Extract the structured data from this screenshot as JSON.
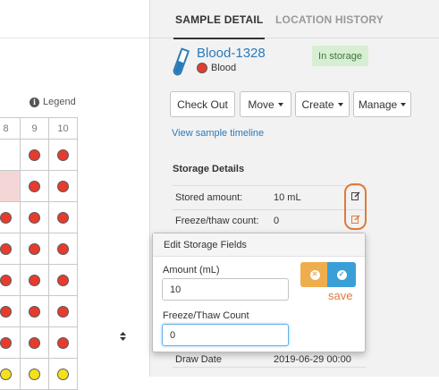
{
  "grid": {
    "legend_label": "Legend",
    "header_labels": [
      "8",
      "9",
      "10"
    ],
    "rows": [
      [
        "empty",
        "red",
        "red"
      ],
      [
        "pink",
        "red",
        "red"
      ],
      [
        "red",
        "red",
        "red"
      ],
      [
        "red",
        "red",
        "red"
      ],
      [
        "red",
        "red",
        "red"
      ],
      [
        "red",
        "red",
        "red"
      ],
      [
        "red",
        "red",
        "red"
      ],
      [
        "yellow",
        "yellow",
        "yellow"
      ]
    ],
    "colors": {
      "red": "#e53c2e",
      "yellow": "#f3e21a",
      "pink": "#f5d6d6"
    }
  },
  "tabs": [
    {
      "label": "SAMPLE DETAIL",
      "active": true
    },
    {
      "label": "LOCATION HISTORY",
      "active": false
    }
  ],
  "sample": {
    "name": "Blood-1328",
    "type": "Blood",
    "status": "In storage",
    "icon": "test-tube-icon"
  },
  "actions": {
    "check_out": "Check Out",
    "move": "Move",
    "create": "Create",
    "manage": "Manage"
  },
  "timeline_link": "View sample timeline",
  "storage": {
    "title": "Storage Details",
    "rows": [
      {
        "label": "Stored amount:",
        "value": "10 mL"
      },
      {
        "label": "Freeze/thaw count:",
        "value": "0"
      }
    ],
    "draw_date_label": "Draw Date",
    "draw_date_value": "2019-06-29 00:00"
  },
  "edit_popup": {
    "title": "Edit Storage Fields",
    "amount_label": "Amount (mL)",
    "amount_value": "10",
    "freeze_thaw_label": "Freeze/Thaw Count",
    "freeze_thaw_value": "0",
    "save_annotation": "save"
  },
  "colors": {
    "link": "#2a7ab8",
    "status_bg": "#d8eed3",
    "status_text": "#3c763d",
    "annotation": "#e07a3c",
    "cancel_button": "#f0ad4e",
    "save_button": "#3a9fd6"
  }
}
